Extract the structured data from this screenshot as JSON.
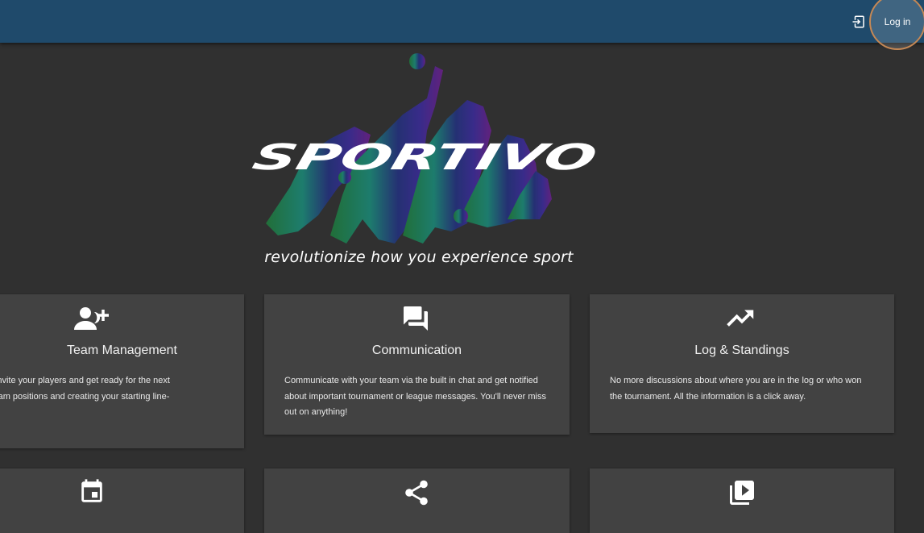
{
  "header": {
    "login_label": "Log in",
    "login_icon": "login-icon",
    "bar_color": "#1f4a6b"
  },
  "hero": {
    "logo_text": "SPORTIVO",
    "tagline": "revolutionize how you experience sport"
  },
  "features": [
    {
      "icon": "group-add-icon",
      "title": "Team Management",
      "desc_lines": [
        "ur teams, invite your players and get ready for the next",
        "ssigning team positions and creating your starting line-"
      ]
    },
    {
      "icon": "forum-icon",
      "title": "Communication",
      "desc_lines": [
        "Communicate with your team via the built in chat and get notified",
        "about important tournament or league messages. You'll never miss",
        "out on anything!"
      ]
    },
    {
      "icon": "trending-up-icon",
      "title": "Log & Standings",
      "desc_lines": [
        "No more discussions about where you are in the log or who won",
        "the tournament. All the information is a click away."
      ]
    },
    {
      "icon": "calendar-icon"
    },
    {
      "icon": "share-icon"
    },
    {
      "icon": "video-library-icon"
    }
  ]
}
